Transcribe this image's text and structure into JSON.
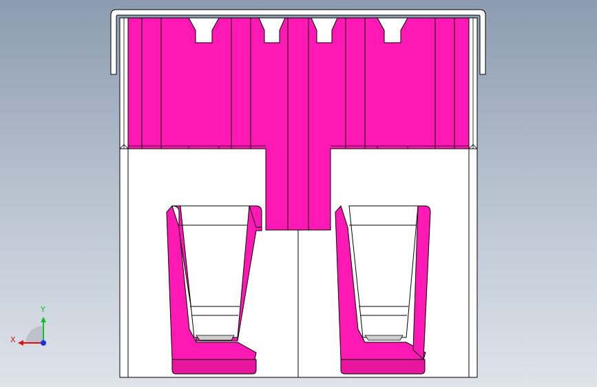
{
  "scene": {
    "title": "",
    "colors": {
      "background_top": "#8c9bb0",
      "background_bottom": "#dfe4ea",
      "pink": "#ff19b4",
      "pink_dark": "#e8159f",
      "white_body": "#ffffff",
      "outline": "#000000"
    }
  },
  "triad": {
    "x_label": "X",
    "y_label": "Y",
    "colors": {
      "x": "#e01010",
      "y": "#10c020",
      "z": "#2030e0"
    }
  }
}
